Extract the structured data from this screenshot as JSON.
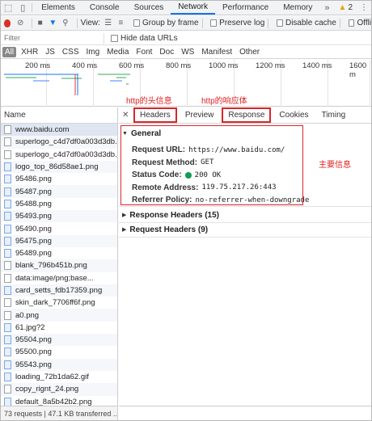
{
  "devtools": {
    "tabs": [
      "Elements",
      "Console",
      "Sources",
      "Network",
      "Performance",
      "Memory"
    ],
    "active_tab": "Network",
    "warnings_count": "2",
    "overflow_tab": "Offli"
  },
  "toolbar": {
    "view_label": "View:",
    "group_by_frame": "Group by frame",
    "preserve_log": "Preserve log",
    "disable_cache": "Disable cache",
    "offline": "Offli"
  },
  "filter": {
    "placeholder": "Filter",
    "hide_data_urls": "Hide data URLs"
  },
  "types": [
    "All",
    "XHR",
    "JS",
    "CSS",
    "Img",
    "Media",
    "Font",
    "Doc",
    "WS",
    "Manifest",
    "Other"
  ],
  "overview": {
    "ticks": [
      "200 ms",
      "400 ms",
      "600 ms",
      "800 ms",
      "1000 ms",
      "1200 ms",
      "1400 ms",
      "1600 m"
    ]
  },
  "requests": {
    "header": "Name",
    "items": [
      {
        "name": "www.baidu.com",
        "icon": "document-icon"
      },
      {
        "name": "superlogo_c4d7df0a003d3db...",
        "icon": "document-icon"
      },
      {
        "name": "superlogo_c4d7df0a003d3db...",
        "icon": "document-icon"
      },
      {
        "name": "logo_top_86d58ae1.png",
        "icon": "image-icon"
      },
      {
        "name": "95486.png",
        "icon": "image-icon"
      },
      {
        "name": "95487.png",
        "icon": "image-icon"
      },
      {
        "name": "95488.png",
        "icon": "image-icon"
      },
      {
        "name": "95493.png",
        "icon": "image-icon"
      },
      {
        "name": "95490.png",
        "icon": "image-icon"
      },
      {
        "name": "95475.png",
        "icon": "image-icon"
      },
      {
        "name": "95489.png",
        "icon": "image-icon"
      },
      {
        "name": "blank_796b451b.png",
        "icon": "document-icon"
      },
      {
        "name": "data:image/png;base...",
        "icon": "document-icon"
      },
      {
        "name": "card_setts_fdb17359.png",
        "icon": "image-icon"
      },
      {
        "name": "skin_dark_7706ff6f.png",
        "icon": "document-icon"
      },
      {
        "name": "a0.png",
        "icon": "document-icon"
      },
      {
        "name": "61.jpg?2",
        "icon": "image-icon"
      },
      {
        "name": "95504.png",
        "icon": "image-icon"
      },
      {
        "name": "95500.png",
        "icon": "image-icon"
      },
      {
        "name": "95543.png",
        "icon": "image-icon"
      },
      {
        "name": "loading_72b1da62.gif",
        "icon": "image-icon"
      },
      {
        "name": "copy_rignt_24.png",
        "icon": "document-icon"
      },
      {
        "name": "default_8a5b42b2.png",
        "icon": "image-icon"
      }
    ]
  },
  "status_bar": "73 requests | 47.1 KB transferred ...",
  "details": {
    "tabs": [
      "Headers",
      "Preview",
      "Response",
      "Cookies",
      "Timing"
    ],
    "general": {
      "title": "General",
      "rows": [
        {
          "key": "Request URL:",
          "value": "https://www.baidu.com/"
        },
        {
          "key": "Request Method:",
          "value": "GET"
        },
        {
          "key": "Status Code:",
          "value": "200 OK"
        },
        {
          "key": "Remote Address:",
          "value": "119.75.217.26:443"
        },
        {
          "key": "Referrer Policy:",
          "value": "no-referrer-when-downgrade"
        }
      ]
    },
    "response_headers": "Response Headers (15)",
    "request_headers": "Request Headers (9)"
  },
  "annotations": {
    "headers_note": "http的头信息",
    "response_note": "http的响应体",
    "main_note": "主要信息"
  },
  "colors": {
    "accent": "#1a73e8",
    "annotation_red": "#d9262c",
    "status_ok": "#0f9d58"
  }
}
